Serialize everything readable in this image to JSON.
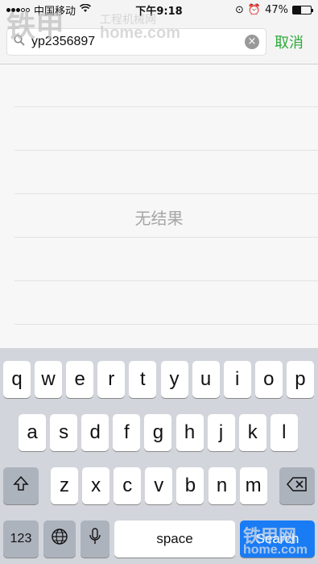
{
  "status_bar": {
    "carrier": "中国移动",
    "time": "下午9:18",
    "battery": "47%",
    "battery_level": 0.47
  },
  "search": {
    "value": "yp2356897",
    "cancel_label": "取消"
  },
  "results": {
    "empty_text": "无结果"
  },
  "keyboard": {
    "row1": [
      "q",
      "w",
      "e",
      "r",
      "t",
      "y",
      "u",
      "i",
      "o",
      "p"
    ],
    "row2": [
      "a",
      "s",
      "d",
      "f",
      "g",
      "h",
      "j",
      "k",
      "l"
    ],
    "row3": [
      "z",
      "x",
      "c",
      "v",
      "b",
      "n",
      "m"
    ],
    "numbers_label": "123",
    "space_label": "space",
    "search_label": "Search",
    "icons": [
      "shift-icon",
      "delete-icon",
      "globe-icon",
      "microphone-icon"
    ]
  },
  "watermark": {
    "top_brand": "铁甲",
    "top_text": "工程机械网",
    "top_domain": "home.com",
    "bottom_brand": "铁甲网",
    "bottom_domain": "home.com"
  },
  "colors": {
    "accent_green": "#2eaa3a",
    "search_blue": "#1a7cf5"
  }
}
